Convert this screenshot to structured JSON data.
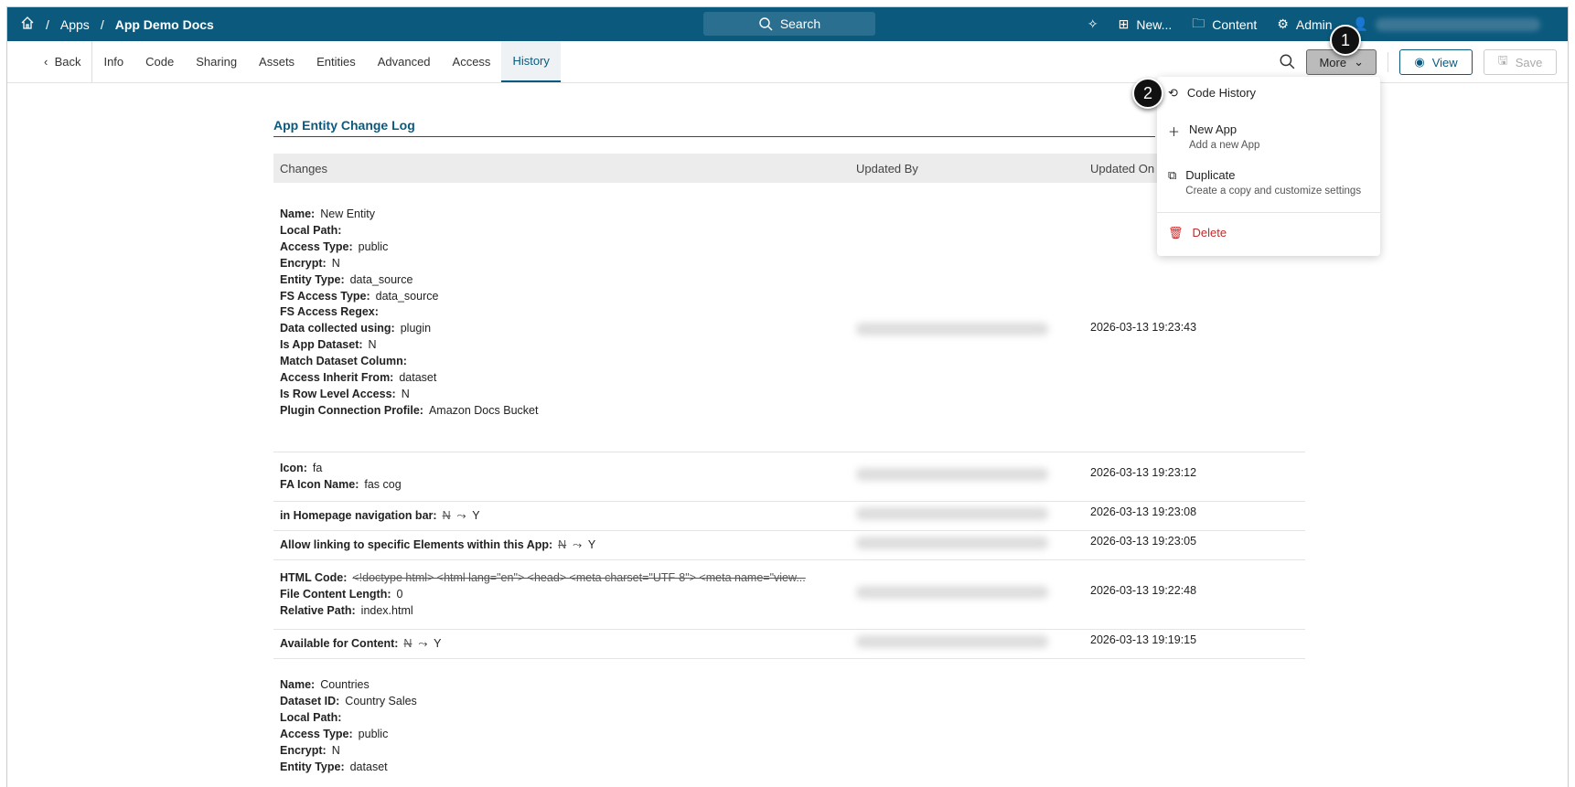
{
  "topbar": {
    "home": "Home",
    "crumb1": "Apps",
    "crumb2": "App Demo Docs",
    "search": "Search",
    "new": "New...",
    "content": "Content",
    "admin": "Admin"
  },
  "tabs": [
    "Back",
    "Info",
    "Code",
    "Sharing",
    "Assets",
    "Entities",
    "Advanced",
    "Access",
    "History"
  ],
  "toolbar": {
    "more": "More",
    "view": "View",
    "save": "Save"
  },
  "menu": {
    "code_history": "Code History",
    "new_app": "New App",
    "new_app_desc": "Add a new App",
    "duplicate": "Duplicate",
    "duplicate_desc": "Create a copy and customize settings",
    "delete": "Delete"
  },
  "badges": [
    "1",
    "2"
  ],
  "page": {
    "title": "App Entity Change Log",
    "headers": [
      "Changes",
      "Updated By",
      "Updated On"
    ]
  },
  "rows": [
    {
      "fields": [
        [
          "Name:",
          "New Entity"
        ],
        [
          "Local Path:",
          ""
        ],
        [
          "Access Type:",
          "public"
        ],
        [
          "Encrypt:",
          "N"
        ],
        [
          "Entity Type:",
          "data_source"
        ],
        [
          "FS Access Type:",
          "data_source"
        ],
        [
          "FS Access Regex:",
          ""
        ],
        [
          "Data collected using:",
          "plugin"
        ],
        [
          "Is App Dataset:",
          "N"
        ],
        [
          "Match Dataset Column:",
          ""
        ],
        [
          "Access Inherit From:",
          "dataset"
        ],
        [
          "Is Row Level Access:",
          "N"
        ],
        [
          "Plugin Connection Profile:",
          "Amazon Docs Bucket"
        ]
      ],
      "on": "2026-03-13 19:23:43"
    },
    {
      "fields": [
        [
          "Icon:",
          "fa"
        ],
        [
          "FA Icon Name:",
          "fas cog"
        ]
      ],
      "on": "2026-03-13 19:23:12"
    },
    {
      "label": "in Homepage navigation bar:",
      "old": "N",
      "arrow": "⤳",
      "new": "Y",
      "on": "2026-03-13 19:23:08"
    },
    {
      "label": "Allow linking to specific Elements within this App:",
      "old": "N",
      "arrow": "⤳",
      "new": "Y",
      "on": "2026-03-13 19:23:05"
    },
    {
      "html_label": "HTML Code:",
      "html_old": "<!doctype html> <html lang=\"en\"> <head> <meta charset=\"UTF-8\"> <meta name=\"view...",
      "fields": [
        [
          "File Content Length:",
          "0"
        ],
        [
          "Relative Path:",
          "index.html"
        ]
      ],
      "on": "2026-03-13 19:22:48"
    },
    {
      "label": "Available for Content:",
      "old": "N",
      "arrow": "⤳",
      "new": "Y",
      "on": "2026-03-13 19:19:15"
    },
    {
      "fields": [
        [
          "Name:",
          "Countries"
        ],
        [
          "Dataset ID:",
          "Country Sales"
        ],
        [
          "Local Path:",
          ""
        ],
        [
          "Access Type:",
          "public"
        ],
        [
          "Encrypt:",
          "N"
        ],
        [
          "Entity Type:",
          "dataset"
        ]
      ]
    }
  ]
}
